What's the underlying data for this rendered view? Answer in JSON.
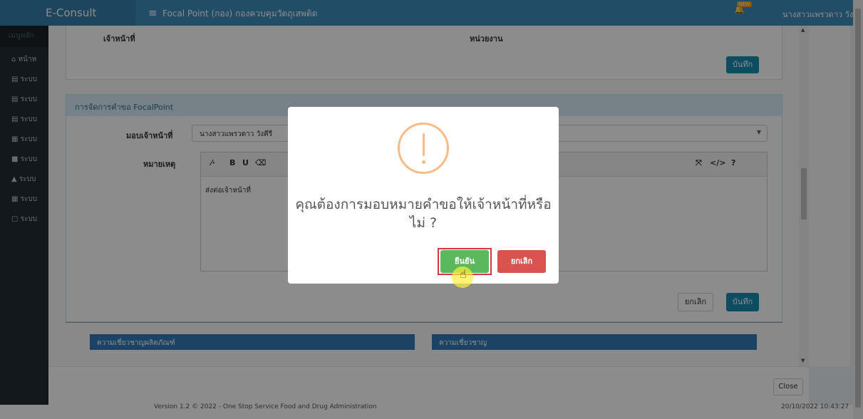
{
  "app": {
    "brand": "E-Consult",
    "title": "Focal Point (กอง) กองควบคุมวัตถุเสพติด",
    "user_name": "นางสาวแพรวดาว วังคี",
    "notif_badge": "NEW"
  },
  "sidebar": {
    "header": "เมนูหลัก",
    "items": [
      {
        "label": "หน้าห",
        "icon": "home-icon"
      },
      {
        "label": "ระบบ",
        "icon": "book-icon"
      },
      {
        "label": "ระบบ",
        "icon": "book-icon"
      },
      {
        "label": "ระบบ",
        "icon": "book-icon"
      },
      {
        "label": "ระบบ",
        "icon": "calendar-icon"
      },
      {
        "label": "ระบบ",
        "icon": "video-icon"
      },
      {
        "label": "ระบบ",
        "icon": "graduation-cap-icon"
      },
      {
        "label": "ระบบ",
        "icon": "calendar-icon"
      },
      {
        "label": "ระบบ",
        "icon": "file-icon"
      }
    ]
  },
  "panel_top": {
    "label_officer": "เจ้าหน้าที่",
    "label_unit": "หน่วยงาน",
    "save_label": "บันทึก"
  },
  "request_panel": {
    "heading": "การจัดการคำขอ FocalPoint",
    "assign_label": "มอบเจ้าหน้าที่",
    "assign_value": "นางสาวแพรวดาว วังคีรี",
    "note_label": "หมายเหตุ",
    "note_text": "ส่งต่อเจ้าหน้าที่",
    "cancel_label": "ยกเลิก",
    "save_label": "บันทึก"
  },
  "expertise": {
    "product": "ความเชี่ยวชาญผลิตภัณฑ์",
    "general": "ความเชี่ยวชาญ"
  },
  "footer": {
    "close_label": "Close",
    "version": "Version 1.2 © 2022 - One Stop Service Food and Drug Administration",
    "datetime": "20/10/2022 10:43:27"
  },
  "dialog": {
    "message": "คุณต้องการมอบหมายคำขอให้เจ้าหน้าที่หรือไม่ ?",
    "confirm_label": "ยืนยัน",
    "cancel_label": "ยกเลิก"
  },
  "colors": {
    "primary": "#3c8dbc",
    "confirm": "#5cb85c",
    "cancel": "#d9534f",
    "warning": "#f8bb86"
  }
}
